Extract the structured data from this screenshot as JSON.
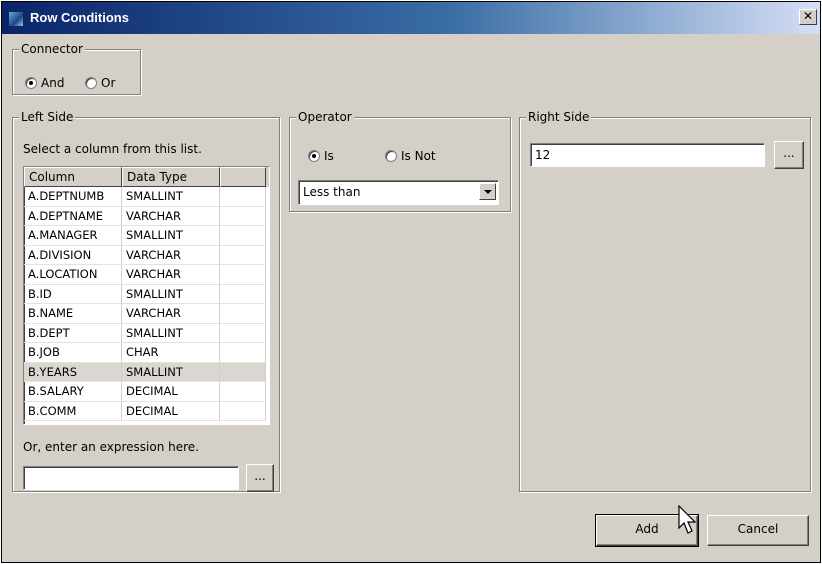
{
  "window": {
    "title": "Row Conditions",
    "close_glyph": "✕"
  },
  "connector": {
    "legend": "Connector",
    "options": [
      {
        "label": "And",
        "checked": true
      },
      {
        "label": "Or",
        "checked": false
      }
    ]
  },
  "left_side": {
    "legend": "Left Side",
    "instruction": "Select a column from this list.",
    "columns": [
      "Column",
      "Data Type",
      ""
    ],
    "rows": [
      [
        "A.DEPTNUMB",
        "SMALLINT"
      ],
      [
        "A.DEPTNAME",
        "VARCHAR"
      ],
      [
        "A.MANAGER",
        "SMALLINT"
      ],
      [
        "A.DIVISION",
        "VARCHAR"
      ],
      [
        "A.LOCATION",
        "VARCHAR"
      ],
      [
        "B.ID",
        "SMALLINT"
      ],
      [
        "B.NAME",
        "VARCHAR"
      ],
      [
        "B.DEPT",
        "SMALLINT"
      ],
      [
        "B.JOB",
        "CHAR"
      ],
      [
        "B.YEARS",
        "SMALLINT"
      ],
      [
        "B.SALARY",
        "DECIMAL"
      ],
      [
        "B.COMM",
        "DECIMAL"
      ]
    ],
    "selected_row": "B.YEARS",
    "expression_label": "Or, enter an expression here.",
    "expression_value": "",
    "browse_label": "..."
  },
  "operator": {
    "legend": "Operator",
    "options": [
      {
        "label": "Is",
        "checked": true
      },
      {
        "label": "Is Not",
        "checked": false
      }
    ],
    "selected": "Less than"
  },
  "right_side": {
    "legend": "Right Side",
    "value": "12",
    "browse_label": "..."
  },
  "buttons": {
    "add": "Add",
    "cancel": "Cancel"
  }
}
